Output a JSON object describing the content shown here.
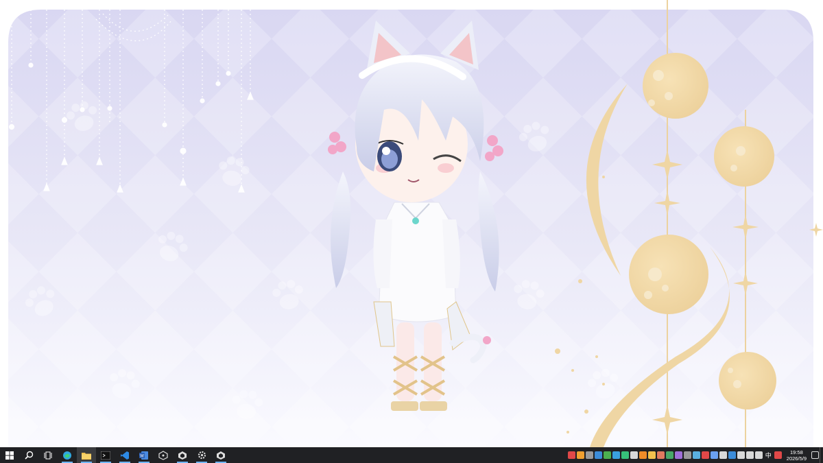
{
  "taskbar": {
    "apps": [
      {
        "name": "start-button",
        "icon": "windows-logo-icon",
        "color": "#ffffff"
      },
      {
        "name": "search-button",
        "icon": "search-icon",
        "color": "#ffffff"
      },
      {
        "name": "task-view-button",
        "icon": "task-view-icon",
        "color": "#ffffff"
      },
      {
        "name": "edge-app",
        "icon": "edge-icon",
        "color": "#2fa8e0"
      },
      {
        "name": "file-explorer-app",
        "icon": "folder-icon",
        "color": "#f2c14e"
      },
      {
        "name": "terminal-app",
        "icon": "terminal-icon",
        "color": "#cccccc"
      },
      {
        "name": "vscode-app",
        "icon": "vscode-icon",
        "color": "#2d8ae5"
      },
      {
        "name": "word-app",
        "icon": "word-icon",
        "color": "#2b5fb4"
      },
      {
        "name": "unity-hub-app",
        "icon": "cube-icon",
        "color": "#dddddd"
      },
      {
        "name": "unity-app",
        "icon": "unity-icon",
        "color": "#dddddd"
      },
      {
        "name": "settings-app",
        "icon": "gear-icon",
        "color": "#dddddd"
      },
      {
        "name": "unity-editor-app",
        "icon": "unity-icon",
        "color": "#dddddd"
      }
    ],
    "tray_colors": [
      "#e04848",
      "#f0a030",
      "#9a9a9a",
      "#3c8cd8",
      "#4cb050",
      "#3aa0e0",
      "#36c07a",
      "#d8d8d8",
      "#f08c28",
      "#f2c14e",
      "#e07a5f",
      "#48a868",
      "#a070d8",
      "#9a9a9a",
      "#5ab0e0",
      "#e04848",
      "#6aa0f0",
      "#d8d8d8",
      "#3c8cd8",
      "#d8d8d8",
      "#d8d8d8",
      "#d8d8d8"
    ],
    "ime_label": "中",
    "clock_time": "19:58",
    "clock_date": "2026/5/9"
  },
  "wallpaper": {
    "accent_lavender": "#d8d6f0",
    "accent_gold": "#efd6a4",
    "hair_color": "#dfe2f3",
    "ribbon_color": "#f2a6c8",
    "dress_color": "#fbfbfd"
  }
}
